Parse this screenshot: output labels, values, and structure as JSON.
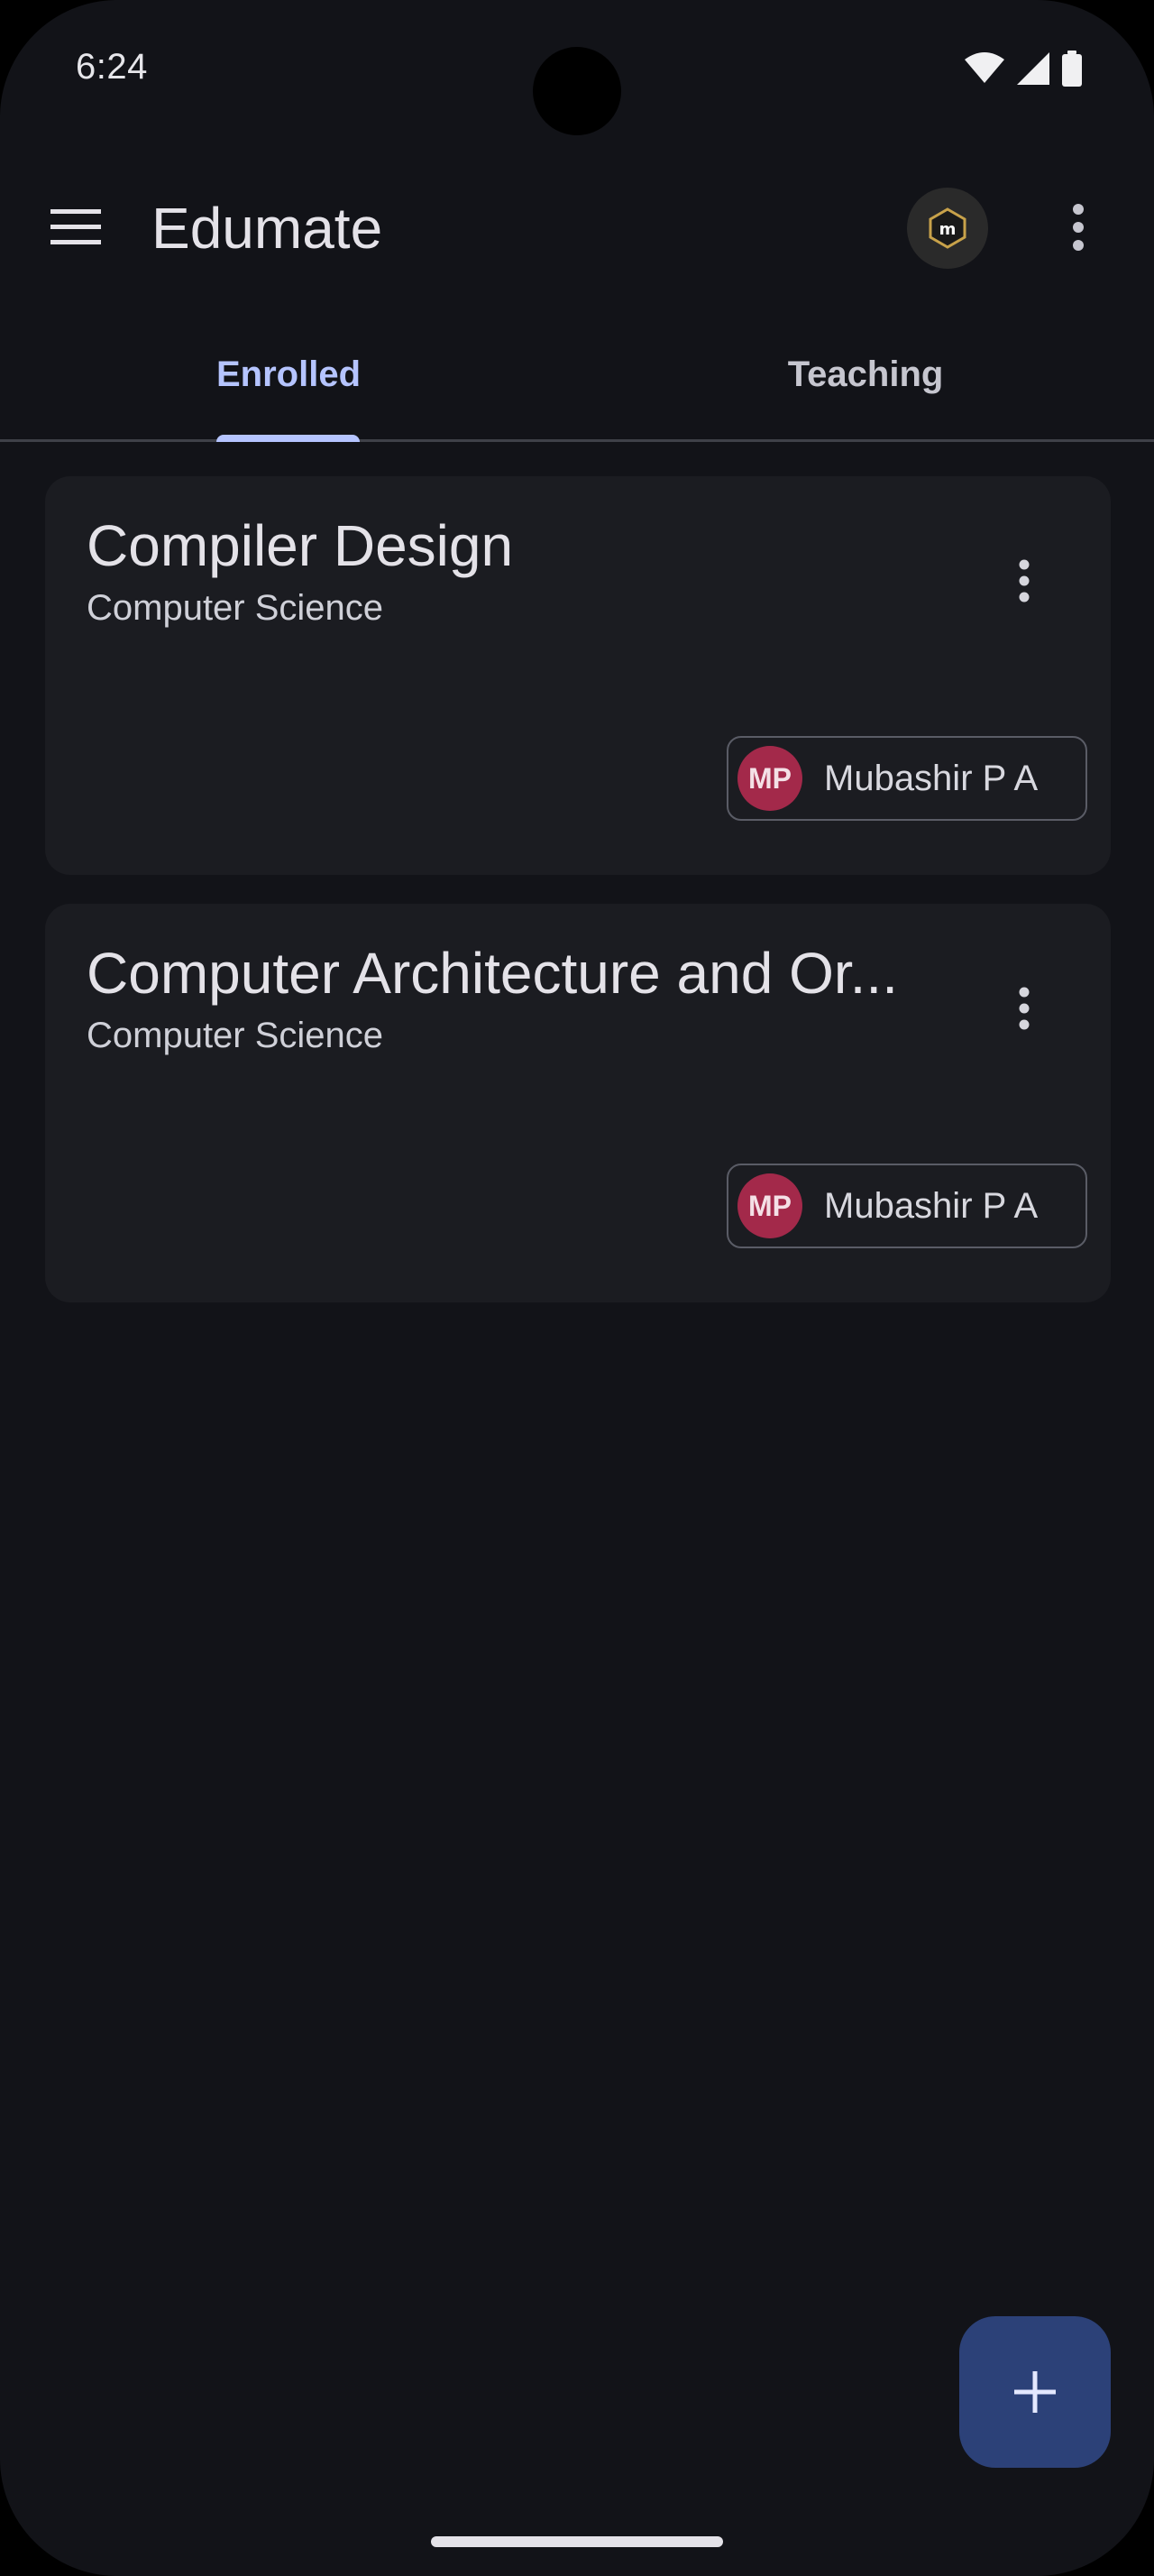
{
  "status_bar": {
    "time": "6:24",
    "icons": [
      "wifi-icon",
      "signal-icon",
      "battery-icon"
    ]
  },
  "app_bar": {
    "title": "Edumate",
    "menu_icon": "hamburger-menu-icon",
    "avatar_icon": "profile-avatar-icon",
    "overflow_icon": "more-vert-icon"
  },
  "tabs": [
    {
      "label": "Enrolled",
      "selected": true
    },
    {
      "label": "Teaching",
      "selected": false
    }
  ],
  "courses": [
    {
      "title": "Compiler Design",
      "subject": "Computer Science",
      "teacher_initials": "MP",
      "teacher_name": "Mubashir P A"
    },
    {
      "title": "Computer Architecture and Or...",
      "subject": "Computer Science",
      "teacher_initials": "MP",
      "teacher_name": "Mubashir P A"
    }
  ],
  "fab": {
    "icon": "add-icon"
  },
  "colors": {
    "background": "#121318",
    "card": "#1b1c21",
    "accent": "#b5c4ff",
    "fab": "#2c4178",
    "teacher_avatar": "#a3294a"
  }
}
